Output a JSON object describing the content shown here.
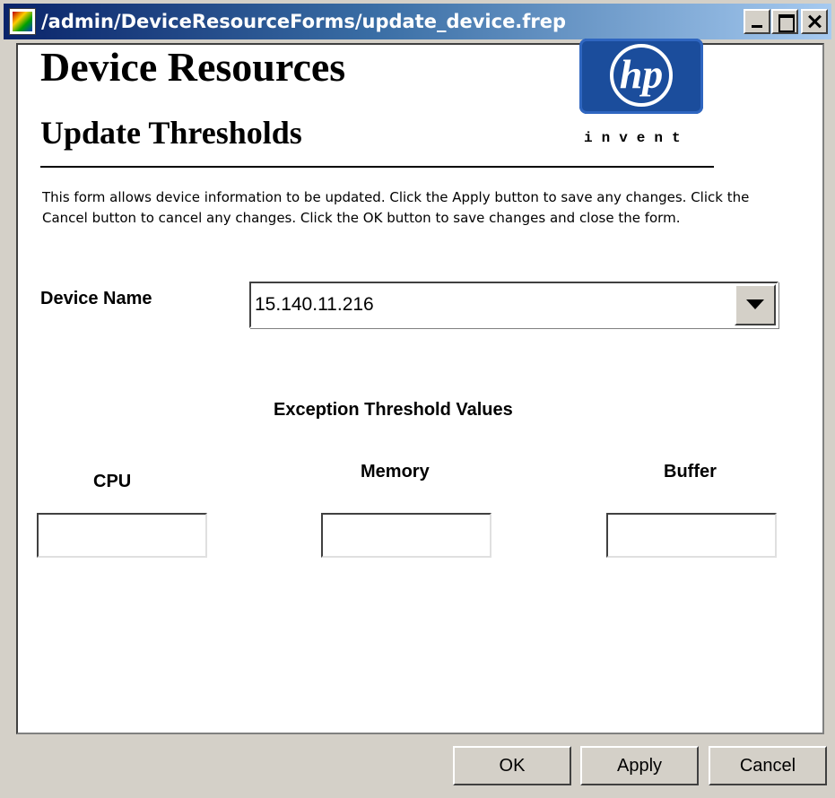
{
  "window": {
    "title": "/admin/DeviceResourceForms/update_device.frep",
    "icon": "application-icon"
  },
  "header": {
    "title": "Device Resources",
    "subtitle": "Update Thresholds",
    "logo": {
      "mark": "hp",
      "tagline": "invent",
      "colors": {
        "primary": "#1b4d9c"
      }
    }
  },
  "description": "This form allows device information to be updated.  Click the Apply button to save any changes.  Click the Cancel button to cancel any changes.   Click the OK button to save changes and close the form.",
  "device": {
    "label": "Device Name",
    "selected_value": "15.140.11.216"
  },
  "thresholds": {
    "title": "Exception Threshold Values",
    "cpu": {
      "label": "CPU",
      "value": ""
    },
    "memory": {
      "label": "Memory",
      "value": ""
    },
    "buffer": {
      "label": "Buffer",
      "value": ""
    }
  },
  "footer": {
    "ok_label": "OK",
    "apply_label": "Apply",
    "cancel_label": "Cancel"
  },
  "colors": {
    "titlebar_start": "#0a246a",
    "titlebar_end": "#a6caf0",
    "dialog_bg": "#d4d0c8",
    "content_bg": "#ffffff"
  }
}
